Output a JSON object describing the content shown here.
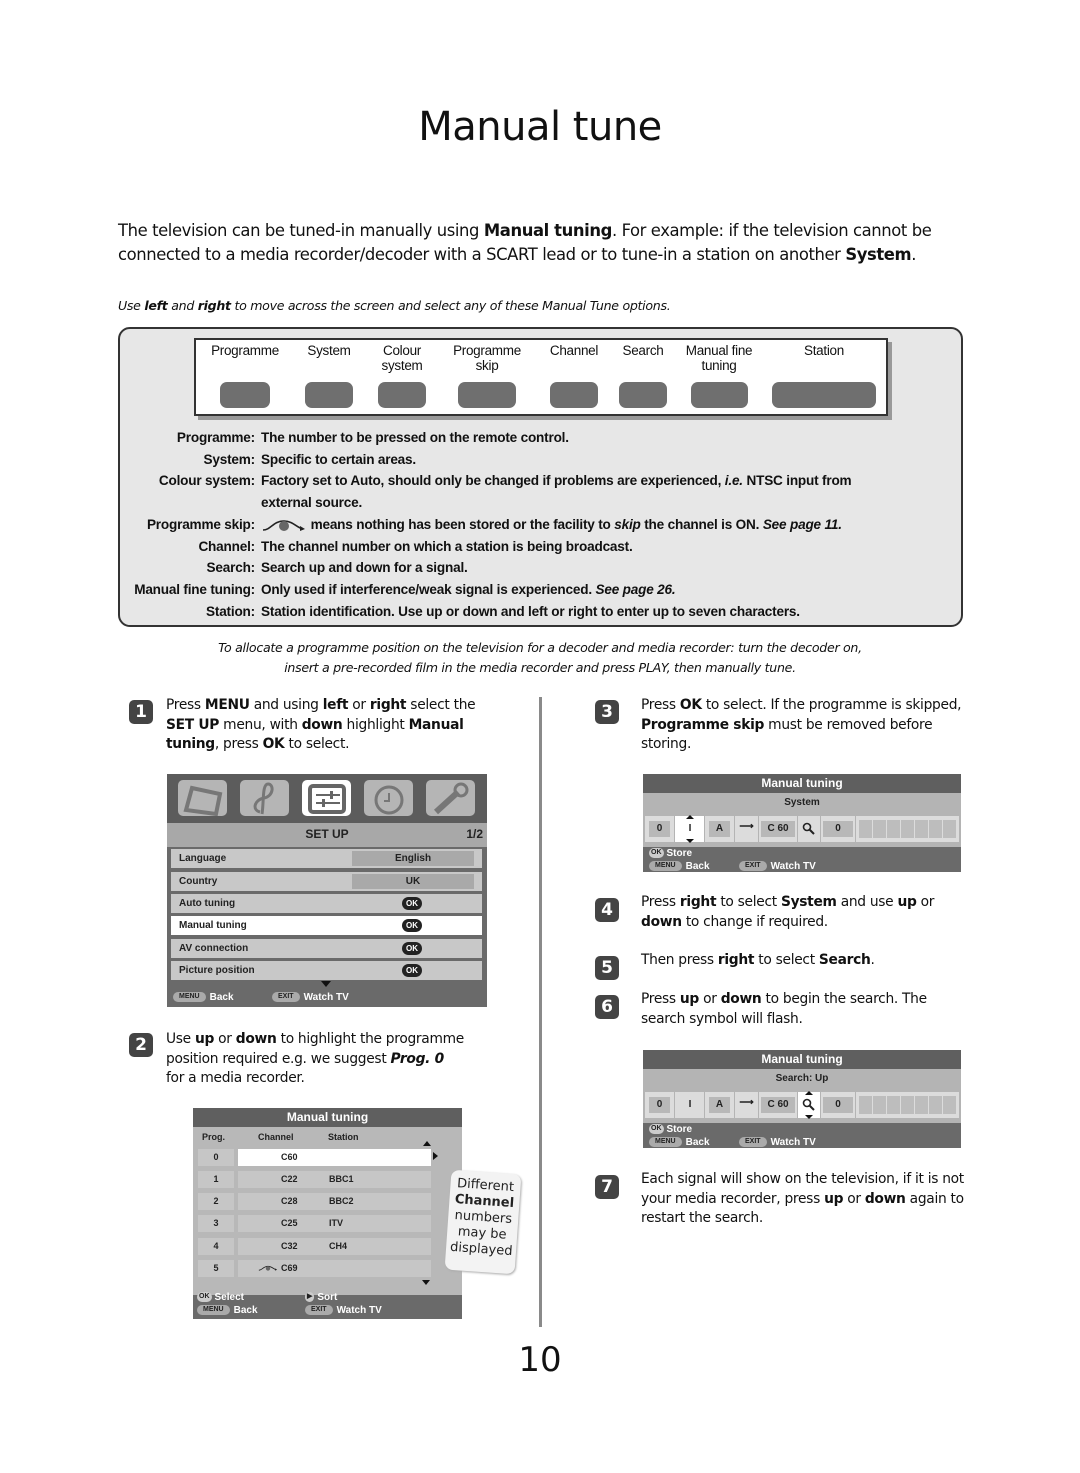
{
  "page": {
    "title": "Manual tune",
    "page_number": "10"
  },
  "intro": {
    "segments": [
      {
        "text": "The television can be tuned-in manually using ",
        "bold": false
      },
      {
        "text": "Manual tuning",
        "bold": true
      },
      {
        "text": ". For example: if the television cannot be connected to a media recorder/decoder with a SCART lead or to tune-in a station on another ",
        "bold": false
      },
      {
        "text": "System",
        "bold": true
      },
      {
        "text": ".",
        "bold": false
      }
    ]
  },
  "hint": {
    "segments": [
      {
        "text": "Use ",
        "bold": false
      },
      {
        "text": "left",
        "bold": true
      },
      {
        "text": " and ",
        "bold": false
      },
      {
        "text": "right",
        "bold": true
      },
      {
        "text": " to move across the screen and select any of these Manual Tune options.",
        "bold": false
      }
    ]
  },
  "options_bar": {
    "options": [
      {
        "label_line1": "Programme",
        "label_line2": ""
      },
      {
        "label_line1": "System",
        "label_line2": ""
      },
      {
        "label_line1": "Colour",
        "label_line2": "system"
      },
      {
        "label_line1": "Programme",
        "label_line2": "skip"
      },
      {
        "label_line1": "Channel",
        "label_line2": ""
      },
      {
        "label_line1": "Search",
        "label_line2": ""
      },
      {
        "label_line1": "Manual fine",
        "label_line2": "tuning"
      },
      {
        "label_line1": "Station",
        "label_line2": ""
      }
    ]
  },
  "definitions": [
    {
      "term": "Programme:",
      "desc": "The number to be pressed on the remote control."
    },
    {
      "term": "System:",
      "desc": "Specific to certain areas."
    },
    {
      "term": "Colour system:",
      "desc": "Factory set to Auto, should only be changed if problems are experienced, ",
      "desc_italic": "i.e.",
      "desc_tail": " NTSC input from"
    },
    {
      "term": "",
      "desc": "external source."
    },
    {
      "term": "Programme skip:",
      "icon": "skip-icon",
      "desc": " means nothing has been stored or the facility to ",
      "desc_italic": "skip",
      "desc_tail": " the channel is ON. ",
      "ref": "See page 11."
    },
    {
      "term": "Channel:",
      "desc": "The channel number on which a station is being broadcast."
    },
    {
      "term": "Search:",
      "desc": "Search up and down for a signal."
    },
    {
      "term": "Manual fine tuning:",
      "desc": "Only used if interference/weak signal is experienced. ",
      "ref": "See page 26."
    },
    {
      "term": "Station:",
      "desc": "Station identification. Use up or down and left or right to enter up to seven characters."
    }
  ],
  "note": {
    "line1": "To allocate a programme position on the television for a decoder and media recorder: turn the decoder on,",
    "line2": "insert a pre-recorded film in the media recorder and press PLAY, then manually tune."
  },
  "steps": [
    {
      "num": "1",
      "segments": [
        {
          "text": "Press ",
          "bold": false
        },
        {
          "text": "MENU",
          "bold": true
        },
        {
          "text": " and using ",
          "bold": false
        },
        {
          "text": "left",
          "bold": true
        },
        {
          "text": " or ",
          "bold": false
        },
        {
          "text": "right",
          "bold": true
        },
        {
          "text": " select the ",
          "bold": false
        },
        {
          "text": "SET UP",
          "bold": true
        },
        {
          "text": " menu, with ",
          "bold": false
        },
        {
          "text": "down",
          "bold": true
        },
        {
          "text": " highlight ",
          "bold": false
        },
        {
          "text": "Manual tuning",
          "bold": true
        },
        {
          "text": ", press ",
          "bold": false
        },
        {
          "text": "OK",
          "bold": true
        },
        {
          "text": " to select.",
          "bold": false
        }
      ]
    },
    {
      "num": "2",
      "segments": [
        {
          "text": "Use ",
          "bold": false
        },
        {
          "text": "up",
          "bold": true
        },
        {
          "text": " or ",
          "bold": false
        },
        {
          "text": "down",
          "bold": true
        },
        {
          "text": " to highlight the programme position required e.g. we suggest ",
          "bold": false
        },
        {
          "text": "Prog. 0",
          "bold": true,
          "italic": true
        },
        {
          "text": " for a media recorder.",
          "bold": false
        }
      ]
    },
    {
      "num": "3",
      "segments": [
        {
          "text": "Press ",
          "bold": false
        },
        {
          "text": "OK",
          "bold": true
        },
        {
          "text": " to select. If the programme is skipped, ",
          "bold": false
        },
        {
          "text": "Programme skip",
          "bold": true
        },
        {
          "text": " must be removed before storing.",
          "bold": false
        }
      ]
    },
    {
      "num": "4",
      "segments": [
        {
          "text": "Press ",
          "bold": false
        },
        {
          "text": "right",
          "bold": true
        },
        {
          "text": " to select ",
          "bold": false
        },
        {
          "text": "System",
          "bold": true
        },
        {
          "text": " and use ",
          "bold": false
        },
        {
          "text": "up",
          "bold": true
        },
        {
          "text": " or ",
          "bold": false
        },
        {
          "text": "down",
          "bold": true
        },
        {
          "text": " to change if required.",
          "bold": false
        }
      ]
    },
    {
      "num": "5",
      "segments": [
        {
          "text": "Then press ",
          "bold": false
        },
        {
          "text": "right",
          "bold": true
        },
        {
          "text": " to select ",
          "bold": false
        },
        {
          "text": "Search",
          "bold": true
        },
        {
          "text": ".",
          "bold": false
        }
      ]
    },
    {
      "num": "6",
      "segments": [
        {
          "text": "Press ",
          "bold": false
        },
        {
          "text": "up",
          "bold": true
        },
        {
          "text": " or ",
          "bold": false
        },
        {
          "text": "down",
          "bold": true
        },
        {
          "text": " to begin the search. The search symbol will flash.",
          "bold": false
        }
      ]
    },
    {
      "num": "7",
      "segments": [
        {
          "text": "Each signal will show on the television, if it is not your media recorder, press ",
          "bold": false
        },
        {
          "text": "up",
          "bold": true
        },
        {
          "text": " or ",
          "bold": false
        },
        {
          "text": "down",
          "bold": true
        },
        {
          "text": " again to restart the search.",
          "bold": false
        }
      ]
    }
  ],
  "setup_menu": {
    "icons": [
      "picture-icon",
      "sound-icon",
      "setup-icon",
      "timer-icon",
      "settings-wrench-icon"
    ],
    "selected_icon": 2,
    "title": "SET UP",
    "page": "1/2",
    "rows": [
      {
        "label": "Language",
        "value": "English",
        "type": "value"
      },
      {
        "label": "Country",
        "value": "UK",
        "type": "value"
      },
      {
        "label": "Auto tuning",
        "value": "OK",
        "type": "ok"
      },
      {
        "label": "Manual tuning",
        "value": "OK",
        "type": "ok",
        "selected": true
      },
      {
        "label": "AV connection",
        "value": "OK",
        "type": "ok"
      },
      {
        "label": "Picture position",
        "value": "OK",
        "type": "ok"
      }
    ],
    "footer": {
      "menu_key": "MENU",
      "menu_label": "Back",
      "exit_key": "EXIT",
      "exit_label": "Watch TV"
    }
  },
  "prog_list": {
    "title": "Manual tuning",
    "headers": {
      "prog": "Prog.",
      "channel": "Channel",
      "station": "Station"
    },
    "rows": [
      {
        "prog": "0",
        "channel": "C60",
        "station": "",
        "selected": true,
        "skip": false
      },
      {
        "prog": "1",
        "channel": "C22",
        "station": "BBC1",
        "skip": false
      },
      {
        "prog": "2",
        "channel": "C28",
        "station": "BBC2",
        "skip": false
      },
      {
        "prog": "3",
        "channel": "C25",
        "station": "ITV",
        "skip": false
      },
      {
        "prog": "4",
        "channel": "C32",
        "station": "CH4",
        "skip": false
      },
      {
        "prog": "5",
        "channel": "C69",
        "station": "",
        "skip": true
      }
    ],
    "footer": {
      "ok_key": "OK",
      "ok_label": "Select",
      "sort_label": "Sort",
      "menu_key": "MENU",
      "menu_label": "Back",
      "exit_key": "EXIT",
      "exit_label": "Watch TV"
    }
  },
  "callout": {
    "line1": "Different",
    "line2": "Channel",
    "line3": "numbers",
    "line4": "may be",
    "line5": "displayed"
  },
  "tuner_system": {
    "title": "Manual tuning",
    "subtitle": "System",
    "fields": {
      "prog": "0",
      "system": "I",
      "colour": "A",
      "skip": "→",
      "channel_prefix": "C",
      "channel": "60",
      "search": "search-icon",
      "fine": "0"
    },
    "selected_field": "system",
    "station_chars": 7,
    "footer": {
      "ok_key": "OK",
      "ok_label": "Store",
      "menu_key": "MENU",
      "menu_label": "Back",
      "exit_key": "EXIT",
      "exit_label": "Watch TV"
    }
  },
  "tuner_search": {
    "title": "Manual tuning",
    "subtitle": "Search: Up",
    "fields": {
      "prog": "0",
      "system": "I",
      "colour": "A",
      "skip": "→",
      "channel_prefix": "C",
      "channel": "60",
      "search": "search-icon",
      "fine": "0"
    },
    "selected_field": "search",
    "station_chars": 7,
    "footer": {
      "ok_key": "OK",
      "ok_label": "Store",
      "menu_key": "MENU",
      "menu_label": "Back",
      "exit_key": "EXIT",
      "exit_label": "Watch TV"
    }
  }
}
